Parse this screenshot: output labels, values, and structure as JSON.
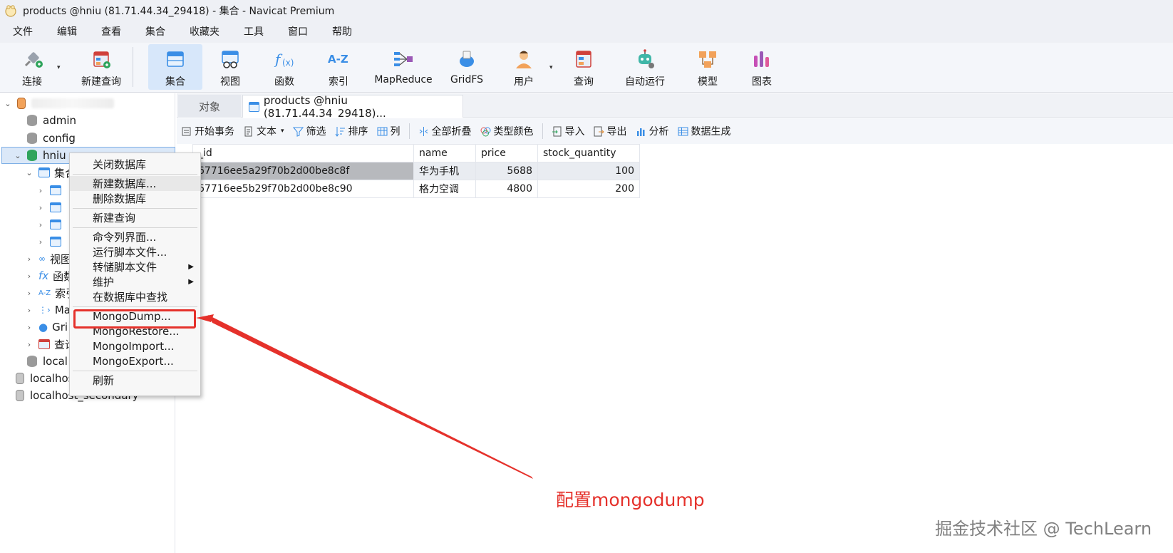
{
  "window": {
    "title": "products @hniu (81.71.44.34_29418) - 集合 - Navicat Premium",
    "app_icon": "navicat-icon"
  },
  "menubar": [
    "文件",
    "编辑",
    "查看",
    "集合",
    "收藏夹",
    "工具",
    "窗口",
    "帮助"
  ],
  "toolbar": {
    "connect": "连接",
    "new_query": "新建查询",
    "collection": "集合",
    "view": "视图",
    "function": "函数",
    "index": "索引",
    "mapreduce": "MapReduce",
    "gridfs": "GridFS",
    "user": "用户",
    "query": "查询",
    "auto_run": "自动运行",
    "model": "模型",
    "chart": "图表"
  },
  "tree": {
    "admin": "admin",
    "config": "config",
    "hniu": "hniu",
    "collections_partial": "集合",
    "views_partial": "视图",
    "functions_partial": "函数",
    "indexes_partial": "索引",
    "mapreduce_partial": "Ma",
    "gridfs_partial": "Gri",
    "queries_partial": "查询",
    "local_partial": "local",
    "localhost_partial": "localhost",
    "localhost_secondary": "localhost_secondary"
  },
  "tabs": {
    "objects": "对象",
    "products": "products @hniu (81.71.44.34_29418)..."
  },
  "data_toolbar": {
    "begin_transaction": "开始事务",
    "text": "文本",
    "filter": "筛选",
    "sort": "排序",
    "columns": "列",
    "collapse_all": "全部折叠",
    "type_color": "类型颜色",
    "import": "导入",
    "export": "导出",
    "analyze": "分析",
    "data_generation": "数据生成"
  },
  "grid": {
    "columns": [
      "_id",
      "name",
      "price",
      "stock_quantity"
    ],
    "rows": [
      [
        "67716ee5a29f70b2d00be8c8f",
        "华为手机",
        "5688",
        "100"
      ],
      [
        "67716ee5b29f70b2d00be8c90",
        "格力空调",
        "4800",
        "200"
      ]
    ]
  },
  "context_menu": {
    "close_db": "关闭数据库",
    "new_db": "新建数据库...",
    "delete_db": "删除数据库",
    "new_query": "新建查询",
    "console": "命令列界面...",
    "run_script": "运行脚本文件...",
    "dump_script": "转储脚本文件",
    "maintain": "维护",
    "find_in_db": "在数据库中查找",
    "mongodump": "MongoDump...",
    "mongorestore": "MongoRestore...",
    "mongoimport": "MongoImport...",
    "mongoexport": "MongoExport...",
    "refresh": "刷新"
  },
  "annotation": {
    "text": "配置mongodump",
    "color": "#e5312b"
  },
  "watermark": "掘金技术社区 @ TechLearn",
  "colors": {
    "accent_blue": "#3a8ee6",
    "selection": "#d7e7fa",
    "annotation_red": "#e5312b"
  }
}
